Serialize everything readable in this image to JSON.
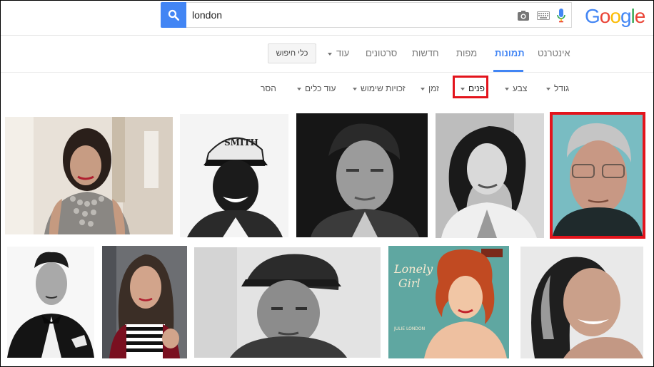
{
  "search": {
    "query": "london"
  },
  "logo": {
    "letters": [
      "G",
      "o",
      "o",
      "g",
      "l",
      "e"
    ],
    "colors": [
      "#4285f4",
      "#ea4335",
      "#fbbc05",
      "#4285f4",
      "#34a853",
      "#ea4335"
    ]
  },
  "tabs": {
    "items": [
      "אינטרנט",
      "תמונות",
      "מפות",
      "חדשות",
      "סרטונים",
      "עוד"
    ],
    "active": "תמונות",
    "tools_label": "כלי חיפוש"
  },
  "filters": {
    "size": "גודל",
    "color": "צבע",
    "faces": "פנים",
    "time": "זמן",
    "usage_rights": "זכויות שימוש",
    "more_tools": "עוד כלים",
    "clear": "הסר"
  },
  "colors": {
    "accent": "#4285f4",
    "highlight": "#e3141c"
  },
  "results_row1": [
    "woman-jewelry-photo",
    "man-cap-photo",
    "man-portrait-bw-photo",
    "woman-portrait-bw-photo",
    "man-glasses-photo"
  ],
  "results_row2": [
    "man-tuxedo-photo",
    "woman-striped-top-photo",
    "man-flat-cap-photo",
    "album-cover-photo",
    "woman-smiling-photo"
  ],
  "album_text": {
    "title_line1": "Lonely",
    "title_line2": "Girl",
    "artist": "JULIE LONDON"
  }
}
